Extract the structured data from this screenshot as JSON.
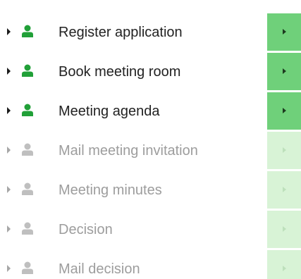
{
  "colors": {
    "active_icon": "#21a038",
    "disabled_icon": "#bfbfbf",
    "active_button": "#6fd07a",
    "disabled_button": "#d8f3d6"
  },
  "steps": [
    {
      "label": "Register application",
      "enabled": true,
      "icon": "person-icon",
      "action_icon": "play-icon"
    },
    {
      "label": "Book meeting room",
      "enabled": true,
      "icon": "person-icon",
      "action_icon": "play-icon"
    },
    {
      "label": "Meeting agenda",
      "enabled": true,
      "icon": "person-icon",
      "action_icon": "play-icon"
    },
    {
      "label": "Mail meeting invitation",
      "enabled": false,
      "icon": "person-icon",
      "action_icon": "play-icon"
    },
    {
      "label": "Meeting minutes",
      "enabled": false,
      "icon": "person-icon",
      "action_icon": "play-icon"
    },
    {
      "label": "Decision",
      "enabled": false,
      "icon": "person-icon",
      "action_icon": "play-icon"
    },
    {
      "label": "Mail decision",
      "enabled": false,
      "icon": "person-icon",
      "action_icon": "play-icon"
    }
  ]
}
